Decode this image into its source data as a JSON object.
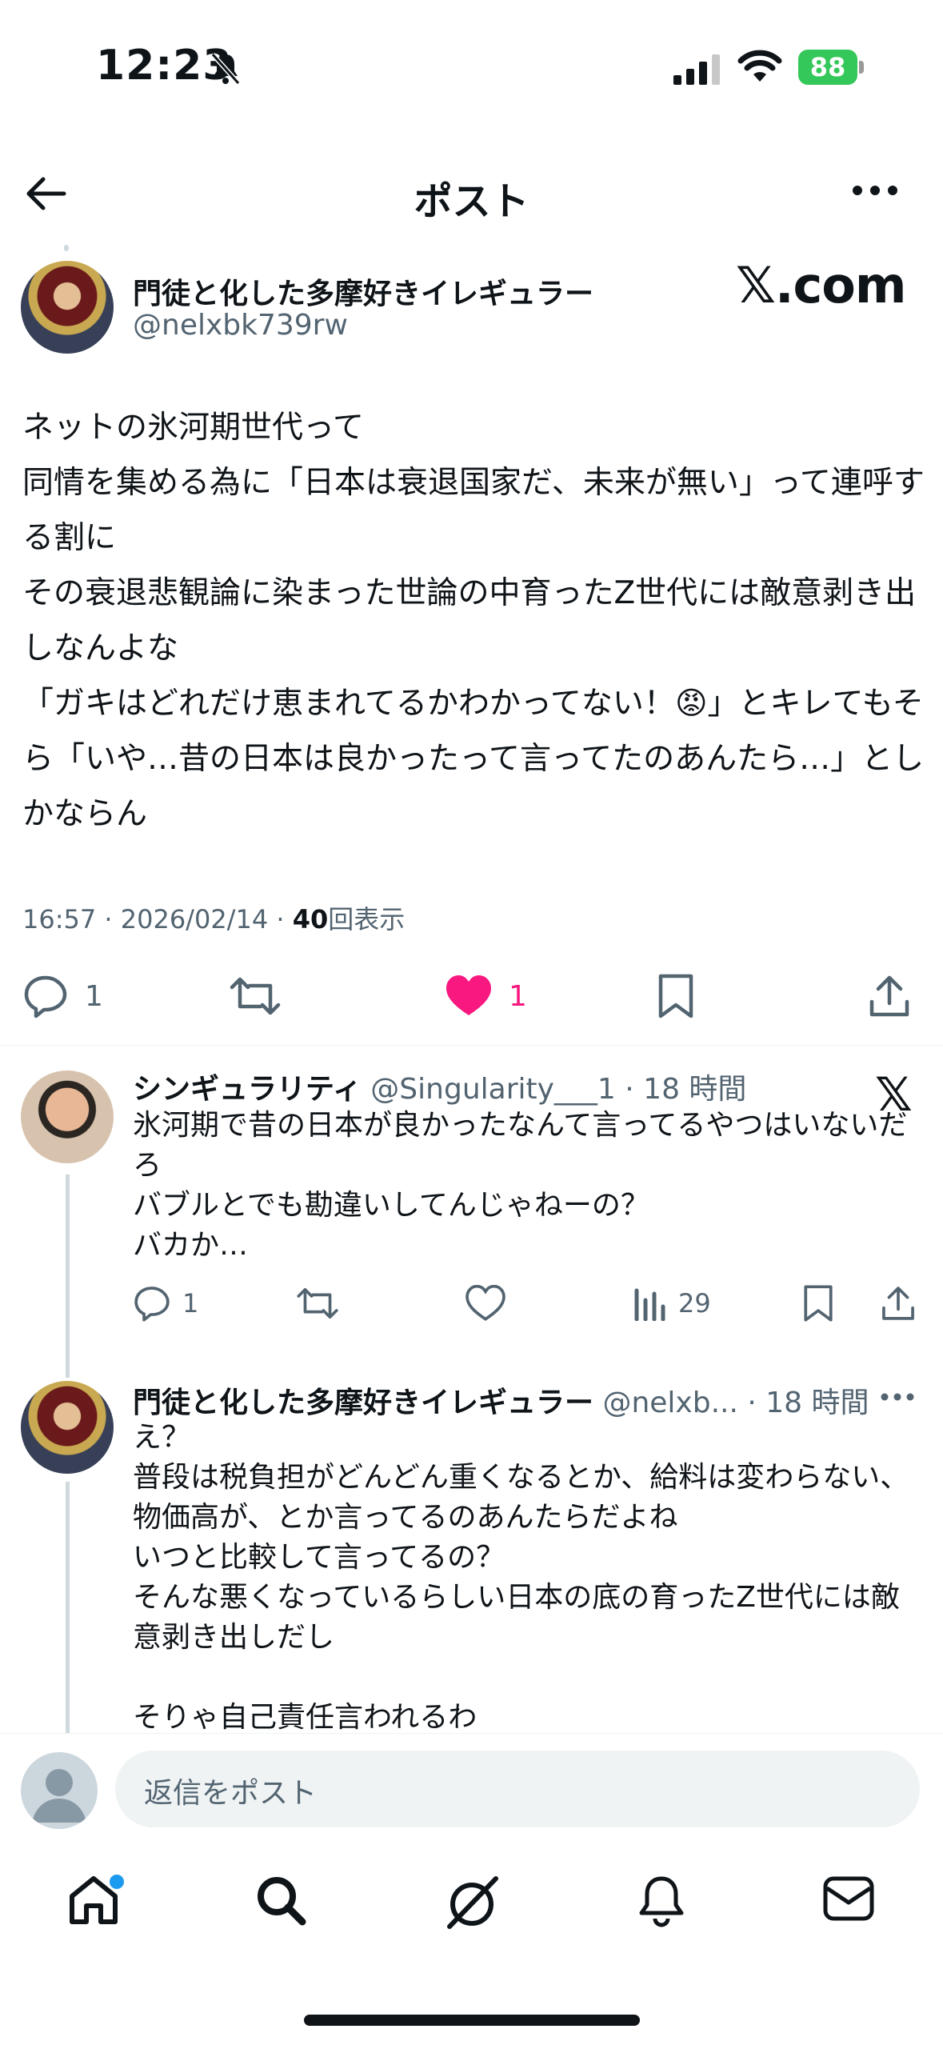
{
  "status_bar": {
    "time": "12:23",
    "battery": "88"
  },
  "header": {
    "title": "ポスト"
  },
  "post": {
    "author_name": "門徒と化した多摩好きイレギュラー",
    "author_handle": "@nelxbk739rw",
    "watermark": "𝕏.com",
    "text": "ネットの氷河期世代って\n同情を集める為に「日本は衰退国家だ、未来が無い」って連呼する割に\nその衰退悲観論に染まった世論の中育ったZ世代には敵意剥き出しなんよな\n「ガキはどれだけ恵まれてるかわかってない！😡」とキレてもそら「いや…昔の日本は良かったって言ってたのあんたら…」としかならん",
    "timestamp": "16:57 · 2026/02/14 · ",
    "views": "40",
    "views_label": "回表示",
    "reply_count": "1",
    "like_count": "1",
    "like_color": "#f91880"
  },
  "replies": [
    {
      "author_name": "シンギュラリティ",
      "author_handle": "@Singularity___1",
      "time": " · 18 時間",
      "text": "氷河期で昔の日本が良かったなんて言ってるやつはいないだろ\nバブルとでも勘違いしてんじゃねーの？\nバカか…",
      "reply_count": "1",
      "views": "29"
    },
    {
      "author_name": "門徒と化した多摩好きイレギュラー",
      "author_handle": "@nelxb...",
      "time": " · 18 時間",
      "text": "え？\n普段は税負担がどんどん重くなるとか、給料は変わらない、物価高が、とか言ってるのあんたらだよね\nいつと比較して言ってるの？\nそんな悪くなっているらしい日本の底の育ったZ世代には敵意剥き出しだし\n\nそりゃ自己責任言われるわ"
    }
  ],
  "composer": {
    "placeholder": "返信をポスト"
  },
  "tabs": [
    "home-icon",
    "search-icon",
    "grok-icon",
    "bell-icon",
    "mail-icon"
  ],
  "accent_color": "#1d9bf0"
}
